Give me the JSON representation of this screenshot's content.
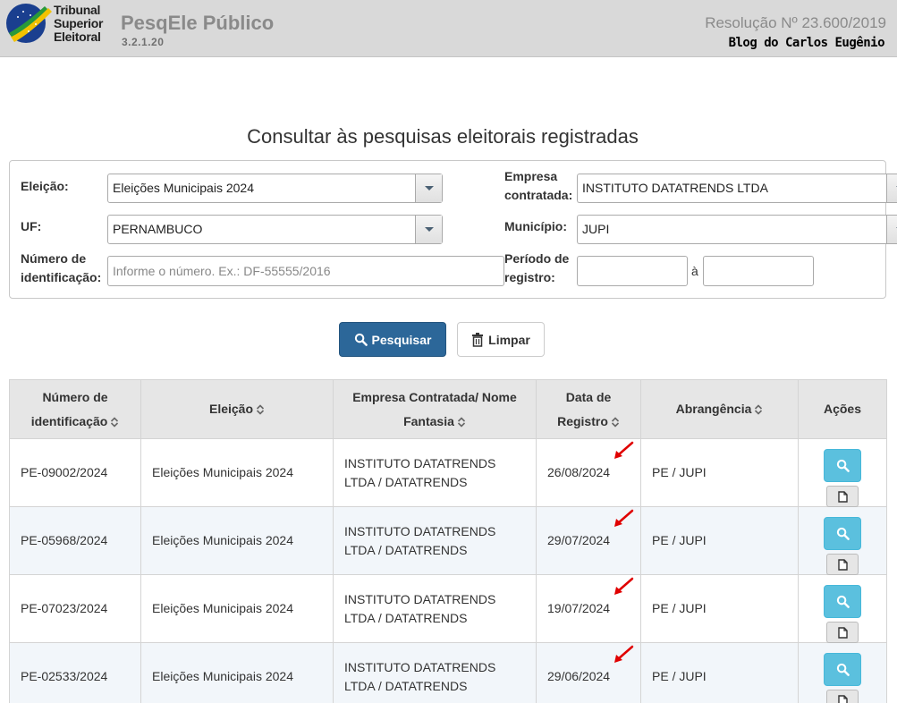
{
  "header": {
    "org_line1": "Tribunal",
    "org_line2": "Superior",
    "org_line3": "Eleitoral",
    "app_title": "PesqEle Público",
    "version": "3.2.1.20",
    "resolution": "Resolução Nº 23.600/2019",
    "blog": "Blog do Carlos Eugênio"
  },
  "page_title": "Consultar às pesquisas eleitorais registradas",
  "filters": {
    "eleicao_label": "Eleição:",
    "eleicao_value": "Eleições Municipais 2024",
    "empresa_label_1": "Empresa",
    "empresa_label_2": "contratada:",
    "empresa_value": "INSTITUTO DATATRENDS LTDA",
    "uf_label": "UF:",
    "uf_value": "PERNAMBUCO",
    "municipio_label": "Município:",
    "municipio_value": "JUPI",
    "numero_label_1": "Número de",
    "numero_label_2": "identificação:",
    "numero_placeholder": "Informe o número. Ex.: DF-55555/2016",
    "periodo_label_1": "Período de",
    "periodo_label_2": "registro:",
    "periodo_sep": "à"
  },
  "buttons": {
    "search": "Pesquisar",
    "clear": "Limpar"
  },
  "table": {
    "headers": {
      "numero_1": "Número de",
      "numero_2": "identificação",
      "eleicao": "Eleição",
      "empresa_1": "Empresa Contratada/ Nome",
      "empresa_2": "Fantasia",
      "data_1": "Data de",
      "data_2": "Registro",
      "abrangencia": "Abrangência",
      "acoes": "Ações"
    },
    "rows": [
      {
        "numero": "PE-09002/2024",
        "eleicao": "Eleições Municipais 2024",
        "empresa_1": "INSTITUTO DATATRENDS",
        "empresa_2": "LTDA / DATATRENDS",
        "data": "26/08/2024",
        "abrangencia": "PE / JUPI"
      },
      {
        "numero": "PE-05968/2024",
        "eleicao": "Eleições Municipais 2024",
        "empresa_1": "INSTITUTO DATATRENDS",
        "empresa_2": "LTDA / DATATRENDS",
        "data": "29/07/2024",
        "abrangencia": "PE / JUPI"
      },
      {
        "numero": "PE-07023/2024",
        "eleicao": "Eleições Municipais 2024",
        "empresa_1": "INSTITUTO DATATRENDS",
        "empresa_2": "LTDA / DATATRENDS",
        "data": "19/07/2024",
        "abrangencia": "PE / JUPI"
      },
      {
        "numero": "PE-02533/2024",
        "eleicao": "Eleições Municipais 2024",
        "empresa_1": "INSTITUTO DATATRENDS",
        "empresa_2": "LTDA / DATATRENDS",
        "data": "29/06/2024",
        "abrangencia": "PE / JUPI"
      }
    ]
  },
  "icons": {
    "search_button": "search-icon",
    "clear_button": "trash-icon",
    "sort": "sort-icon",
    "row_view": "search-icon",
    "row_pdf": "document-icon",
    "annotation": "red-arrow-icon"
  },
  "colors": {
    "primary_button": "#2c6799",
    "view_button": "#5bc0de",
    "annotation_arrow": "#e00000",
    "header_bg": "#d9d9d9"
  }
}
